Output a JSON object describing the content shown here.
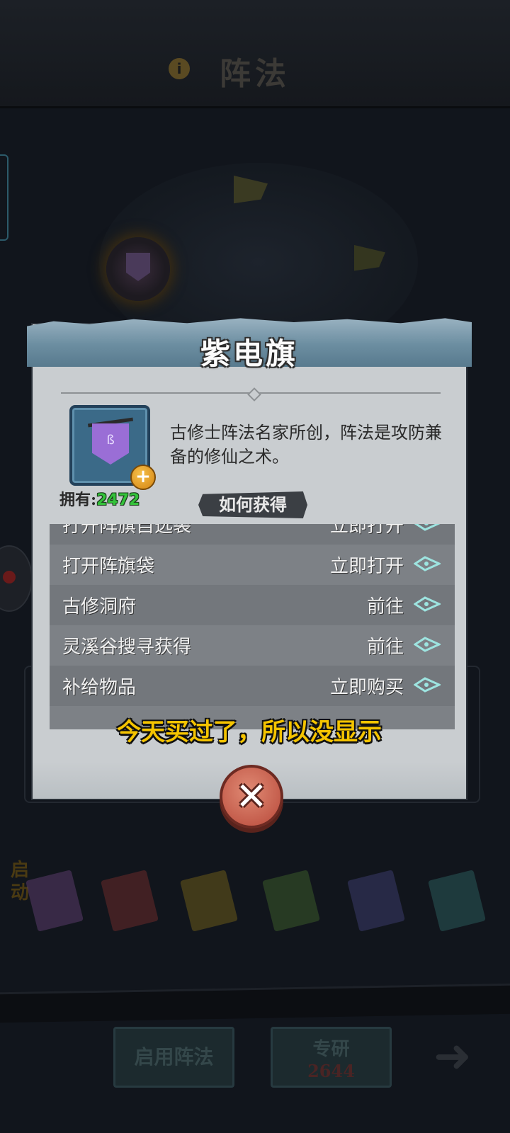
{
  "background": {
    "screen_title": "阵法",
    "start_label": "启动",
    "enable_button": "启用阵法",
    "research_button": "专研",
    "research_cost": "2644",
    "book_colors": [
      "#5a3a6a",
      "#6a2a2a",
      "#6a5a1a",
      "#3a5a2a",
      "#3a3a6a",
      "#2a5a5a"
    ]
  },
  "popup": {
    "title": "紫电旗",
    "description": "古修士阵法名家所创，阵法是攻防兼备的修仙之术。",
    "owned_label": "拥有:",
    "owned_value": "2472",
    "how_to_get_label": "如何获得",
    "plus_icon": "+",
    "close_icon": "✕",
    "sources": [
      {
        "name": "打开阵旗自选袋",
        "action": "立即打开"
      },
      {
        "name": "打开阵旗袋",
        "action": "立即打开"
      },
      {
        "name": "古修洞府",
        "action": "前往"
      },
      {
        "name": "灵溪谷搜寻获得",
        "action": "前往"
      },
      {
        "name": "补给物品",
        "action": "立即购买"
      }
    ]
  },
  "caption": "今天买过了，所以没显示",
  "colors": {
    "owned_value": "#34c23a",
    "caption": "#f5c400",
    "arrow_icon": "#9de4e0"
  }
}
